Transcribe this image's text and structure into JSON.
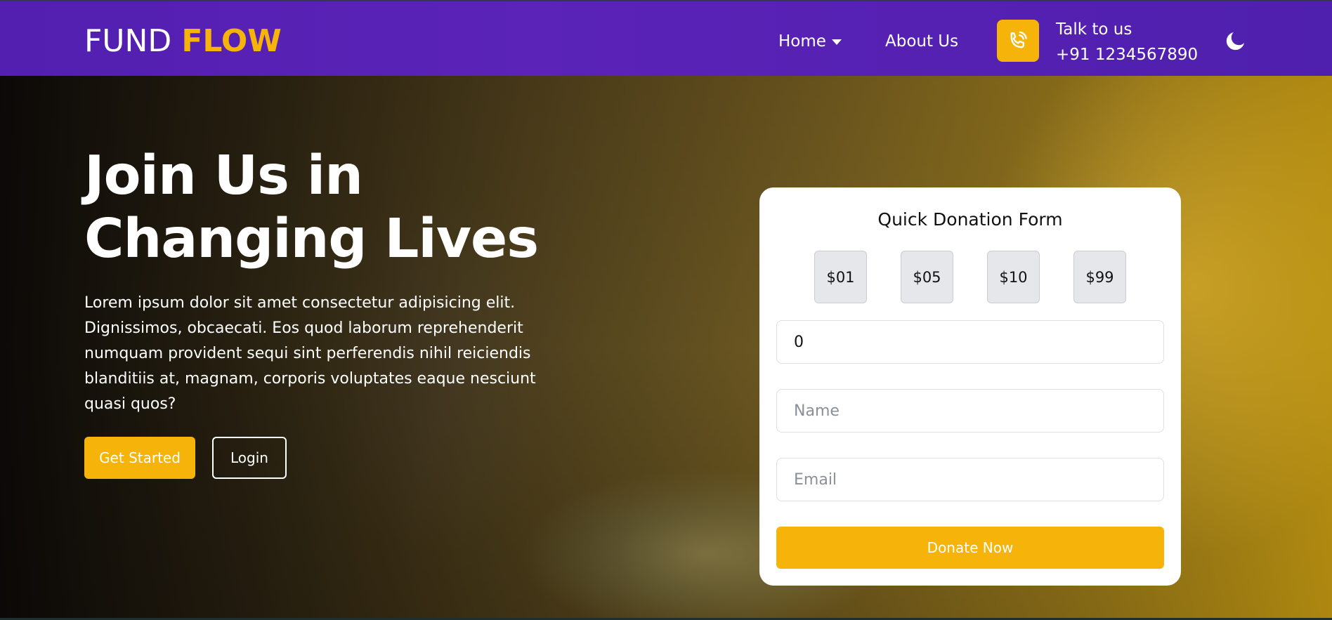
{
  "colors": {
    "brand_purple": "#5b23b8",
    "accent_yellow": "#f6b40b",
    "white": "#ffffff",
    "amount_bg": "#e5e7eb"
  },
  "navbar": {
    "logo_part1": "FUND",
    "logo_part2": "FLOW",
    "home_label": "Home",
    "about_label": "About Us",
    "phone_icon": "phone-icon",
    "talk_label": "Talk to us",
    "phone_number": "+91 1234567890",
    "theme_icon": "moon-icon"
  },
  "hero": {
    "title": "Join Us in Changing Lives",
    "text": "Lorem ipsum dolor sit amet consectetur adipisicing elit. Dignissimos, obcaecati. Eos quod laborum reprehenderit numquam provident sequi sint perferendis nihil reiciendis blanditiis at, magnam, corporis voluptates eaque nesciunt quasi quos?",
    "get_started_label": "Get Started",
    "login_label": "Login"
  },
  "donation_form": {
    "title": "Quick Donation Form",
    "amounts": [
      "$01",
      "$05",
      "$10",
      "$99"
    ],
    "amount_value": "0",
    "name_placeholder": "Name",
    "email_placeholder": "Email",
    "submit_label": "Donate Now"
  }
}
